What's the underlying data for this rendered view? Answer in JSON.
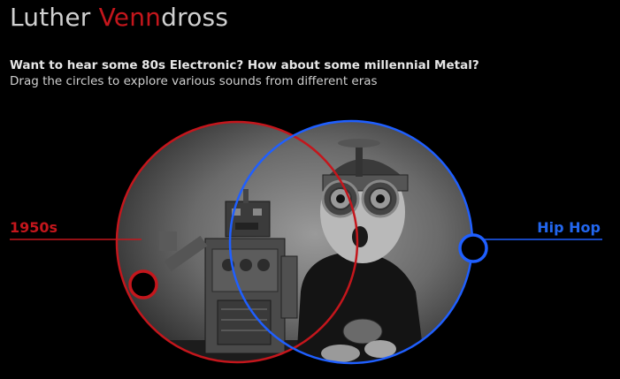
{
  "header": {
    "title_prefix": "Luther ",
    "title_accent": "Venn",
    "title_suffix": "dross"
  },
  "intro": {
    "prompt": "Want to hear some 80s Electronic? How about some millennial Metal?",
    "instructions": "Drag the circles to explore various sounds from different eras"
  },
  "venn": {
    "era_label": "1950s",
    "genre_label": "Hip Hop",
    "colors": {
      "era": "#c4161c",
      "genre": "#1f5fff",
      "background": "#000000"
    }
  }
}
